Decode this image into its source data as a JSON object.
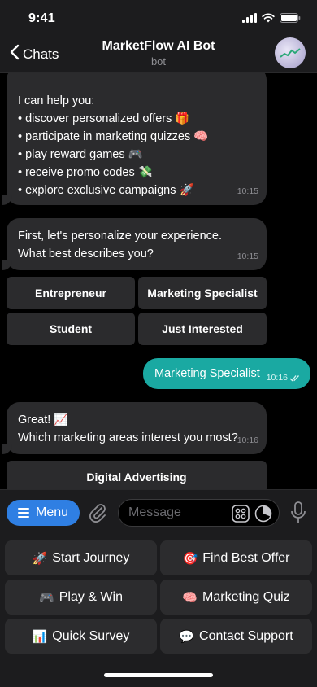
{
  "status": {
    "time": "9:41"
  },
  "header": {
    "back_label": "Chats",
    "title": "MarketFlow AI Bot",
    "subtitle": "bot"
  },
  "messages": {
    "m1": {
      "lines": [
        "I can help you:",
        "• discover personalized offers 🎁",
        "• participate in marketing quizzes 🧠",
        "• play reward games 🎮",
        "• receive promo codes 💸",
        "• explore exclusive campaigns 🚀"
      ],
      "time": "10:15"
    },
    "m2": {
      "lines": [
        "First, let's personalize your experience.",
        "What best describes you?"
      ],
      "time": "10:15"
    },
    "m2_buttons": [
      "Entrepreneur",
      "Marketing Specialist",
      "Student",
      "Just Interested"
    ],
    "m3": {
      "text": "Marketing Specialist",
      "time": "10:16"
    },
    "m4": {
      "lines": [
        "Great! 📈",
        "Which marketing areas interest you most?"
      ],
      "time": "10:16"
    },
    "m4_buttons": [
      "Digital Advertising"
    ]
  },
  "input": {
    "menu_label": "Menu",
    "placeholder": "Message"
  },
  "keyboard": [
    {
      "icon": "🚀",
      "label": "Start Journey"
    },
    {
      "icon": "🎯",
      "label": "Find Best Offer"
    },
    {
      "icon": "🎮",
      "label": "Play & Win"
    },
    {
      "icon": "🧠",
      "label": "Marketing Quiz"
    },
    {
      "icon": "📊",
      "label": "Quick Survey"
    },
    {
      "icon": "💬",
      "label": "Contact Support"
    }
  ],
  "colors": {
    "accent": "#2f7fe3",
    "outgoing": "#1aa9a2",
    "bubble": "#2b2b2d"
  }
}
